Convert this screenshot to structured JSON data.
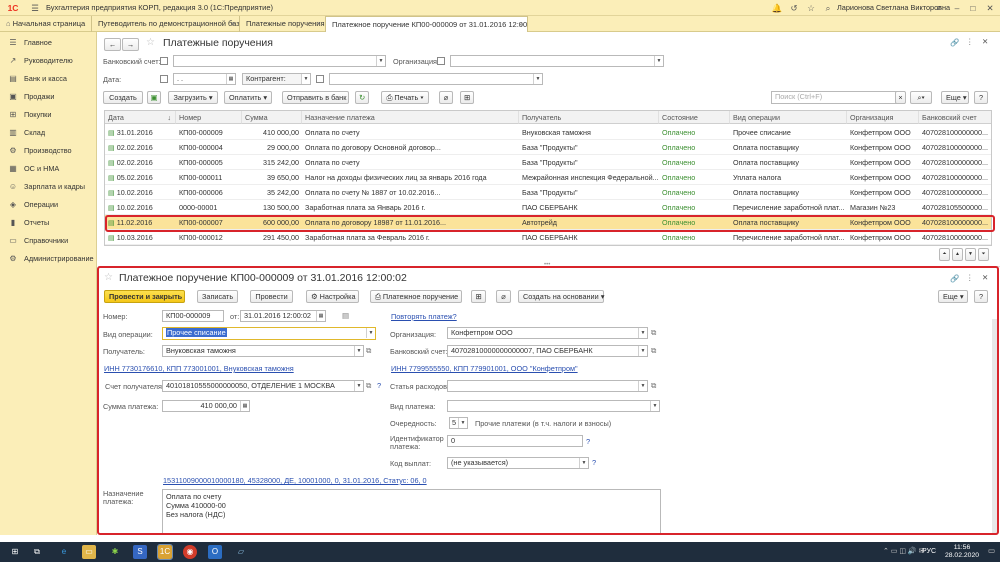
{
  "app": {
    "title": "Бухгалтерия предприятия КОРП, редакция 3.0  (1С:Предприятие)",
    "user": "Ларионова Светлана Викторовна"
  },
  "tabs": [
    {
      "label": "Начальная страница"
    },
    {
      "label": "Путеводитель по демонстрационной базе"
    },
    {
      "label": "Платежные поручения"
    },
    {
      "label": "Платежное поручение КП00-000009 от 31.01.2016 12:00:02"
    }
  ],
  "sidebar": {
    "items": [
      {
        "label": "Главное",
        "icon": "menu-icon"
      },
      {
        "label": "Руководителю",
        "icon": "chart-icon"
      },
      {
        "label": "Банк и касса",
        "icon": "bank-icon"
      },
      {
        "label": "Продажи",
        "icon": "sales-icon"
      },
      {
        "label": "Покупки",
        "icon": "cart-icon"
      },
      {
        "label": "Склад",
        "icon": "warehouse-icon"
      },
      {
        "label": "Производство",
        "icon": "production-icon"
      },
      {
        "label": "ОС и НМА",
        "icon": "assets-icon"
      },
      {
        "label": "Зарплата и кадры",
        "icon": "people-icon"
      },
      {
        "label": "Операции",
        "icon": "operations-icon"
      },
      {
        "label": "Отчеты",
        "icon": "reports-icon"
      },
      {
        "label": "Справочники",
        "icon": "book-icon"
      },
      {
        "label": "Администрирование",
        "icon": "gear-icon"
      }
    ]
  },
  "list": {
    "title": "Платежные поручения",
    "filters": {
      "bank_account_label": "Банковский счет:",
      "org_label": "Организация:",
      "date_label": "Дата:",
      "date_value": ". .",
      "counterparty_label": "Контрагент:"
    },
    "toolbar": {
      "create": "Создать",
      "upload": "Загрузить",
      "payment": "Оплатить",
      "send_bank": "Отправить в банк",
      "print": "Печать",
      "search_placeholder": "Поиск (Ctrl+F)",
      "more": "Еще",
      "help": "?"
    },
    "columns": [
      "Дата",
      "Номер",
      "Сумма",
      "Назначение платежа",
      "Получатель",
      "Состояние",
      "Вид операции",
      "Организация",
      "Банковский счет"
    ],
    "rows": [
      {
        "date": "31.01.2016",
        "number": "КП00-000009",
        "sum": "410 000,00",
        "purpose": "Оплата по счету",
        "recipient": "Внуковская таможня",
        "status": "Оплачено",
        "op": "Прочее списание",
        "org": "Конфетпром ООО",
        "account": "407028100000000..."
      },
      {
        "date": "02.02.2016",
        "number": "КП00-000004",
        "sum": "29 000,00",
        "purpose": "Оплата по договору Основной договор...",
        "recipient": "База \"Продукты\"",
        "status": "Оплачено",
        "op": "Оплата поставщику",
        "org": "Конфетпром ООО",
        "account": "407028100000000..."
      },
      {
        "date": "02.02.2016",
        "number": "КП00-000005",
        "sum": "315 242,00",
        "purpose": "Оплата по счету",
        "recipient": "База \"Продукты\"",
        "status": "Оплачено",
        "op": "Оплата поставщику",
        "org": "Конфетпром ООО",
        "account": "407028100000000..."
      },
      {
        "date": "05.02.2016",
        "number": "КП00-000011",
        "sum": "39 650,00",
        "purpose": "Налог на доходы физических лиц за январь 2016 года",
        "recipient": "Межрайонная инспекция Федеральной...",
        "status": "Оплачено",
        "op": "Уплата налога",
        "org": "Конфетпром ООО",
        "account": "407028100000000..."
      },
      {
        "date": "10.02.2016",
        "number": "КП00-000006",
        "sum": "35 242,00",
        "purpose": "Оплата по счету № 1887 от 10.02.2016...",
        "recipient": "База \"Продукты\"",
        "status": "Оплачено",
        "op": "Оплата поставщику",
        "org": "Конфетпром ООО",
        "account": "407028100000000..."
      },
      {
        "date": "10.02.2016",
        "number": "0000-00001",
        "sum": "130 500,00",
        "purpose": "Заработная плата за Январь 2016 г.",
        "recipient": "ПАО СБЕРБАНК",
        "status": "Оплачено",
        "op": "Перечисление заработной плат...",
        "org": "Магазин №23",
        "account": "407028105500000..."
      },
      {
        "date": "11.02.2016",
        "number": "КП00-000007",
        "sum": "600 000,00",
        "purpose": "Оплата по договору 18987 от 11.01.2016...",
        "recipient": "Автотрейд",
        "status": "Оплачено",
        "op": "Оплата поставщику",
        "org": "Конфетпром ООО",
        "account": "407028100000000..."
      },
      {
        "date": "10.03.2016",
        "number": "КП00-000012",
        "sum": "291 450,00",
        "purpose": "Заработная плата за Февраль 2016 г.",
        "recipient": "ПАО СБЕРБАНК",
        "status": "Оплачено",
        "op": "Перечисление заработной плат...",
        "org": "Конфетпром ООО",
        "account": "407028100000000..."
      }
    ]
  },
  "doc": {
    "title": "Платежное поручение КП00-000009 от 31.01.2016 12:00:02",
    "buttons": {
      "post_close": "Провести и закрыть",
      "save": "Записать",
      "post": "Провести",
      "settings": "Настройка",
      "payment_order": "Платежное поручение",
      "create_basis": "Создать на основании",
      "more": "Еще",
      "help": "?"
    },
    "number_label": "Номер:",
    "number": "КП00-000009",
    "from_label": "от:",
    "date": "31.01.2016 12:00:02",
    "repeat_payment": "Повторять платеж?",
    "op_label": "Вид операции:",
    "op_value": "Прочее списание",
    "org_label": "Организация:",
    "org_value": "Конфетпром ООО",
    "recipient_label": "Получатель:",
    "recipient_value": "Внуковская таможня",
    "bank_account_label": "Банковский счет:",
    "bank_account_value": "40702810000000000007, ПАО СБЕРБАНК",
    "recipient_inn": "ИНН 7730176610, КПП 773001001, Внуковская таможня",
    "org_inn": "ИНН 7799555550, КПП 779901001, ООО \"Конфетпром\"",
    "recipient_account_label": "Счет получателя:",
    "recipient_account_value": "40101810555000000050, ОТДЕЛЕНИЕ 1 МОСКВА",
    "expense_item_label": "Статья расходов:",
    "sum_label": "Сумма платежа:",
    "sum_value": "410 000,00",
    "payment_type_label": "Вид платежа:",
    "priority_label": "Очередность:",
    "priority_value": "5",
    "priority_text": "Прочие платежи (в т.ч. налоги и взносы)",
    "payment_id_label": "Идентификатор платежа:",
    "payment_id_value": "0",
    "income_code_label": "Код выплат:",
    "income_code_value": "(не указывается)",
    "tax_details": "15311009000010000180, 45328000, ДЕ, 10001000, 0, 31.01.2016, Статус: 06, 0",
    "purpose_label": "Назначение платежа:",
    "purpose_lines": [
      "Оплата по счету",
      "Сумма 410000-00",
      "Без налога (НДС)"
    ]
  },
  "taskbar": {
    "time": "11:56",
    "date": "28.02.2020",
    "lang": "РУС"
  }
}
